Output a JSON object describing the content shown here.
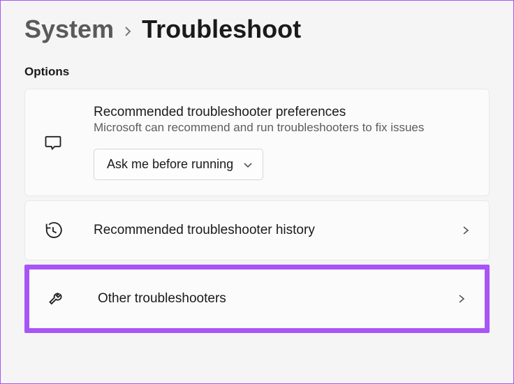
{
  "breadcrumb": {
    "parent": "System",
    "current": "Troubleshoot"
  },
  "section_label": "Options",
  "preferences": {
    "title": "Recommended troubleshooter preferences",
    "subtitle": "Microsoft can recommend and run troubleshooters to fix issues",
    "dropdown_value": "Ask me before running"
  },
  "rows": {
    "history": "Recommended troubleshooter history",
    "other": "Other troubleshooters"
  }
}
